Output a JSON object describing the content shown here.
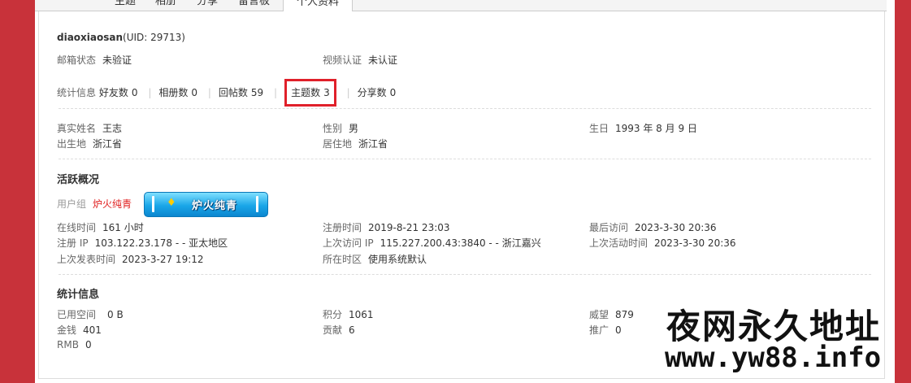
{
  "tabs": [
    "主题",
    "相册",
    "分享",
    "留言板",
    "个人资料"
  ],
  "profile": {
    "username": "diaoxiaosan",
    "uid": "(UID: 29713)",
    "email_label": "邮箱状态",
    "email_value": "未验证",
    "video_label": "视频认证",
    "video_value": "未认证"
  },
  "stats_bar": {
    "label": "统计信息",
    "items": [
      {
        "label": "好友数",
        "count": "0"
      },
      {
        "label": "相册数",
        "count": "0"
      },
      {
        "label": "回帖数",
        "count": "59"
      },
      {
        "label": "主题数",
        "count": "3"
      },
      {
        "label": "分享数",
        "count": "0"
      }
    ]
  },
  "personal": {
    "realname_label": "真实姓名",
    "realname": "王志",
    "gender_label": "性别",
    "gender": "男",
    "birthday_label": "生日",
    "birthday": "1993 年 8 月 9 日",
    "birthplace_label": "出生地",
    "birthplace": "浙江省",
    "residence_label": "居住地",
    "residence": "浙江省"
  },
  "activity": {
    "title": "活跃概况",
    "group_label": "用户组",
    "group_name": "炉火纯青",
    "badge_text": "炉火纯青",
    "online_label": "在线时间",
    "online": "161 小时",
    "reg_time_label": "注册时间",
    "reg_time": "2019-8-21 23:03",
    "last_visit_label": "最后访问",
    "last_visit": "2023-3-30 20:36",
    "reg_ip_label": "注册 IP",
    "reg_ip": "103.122.23.178 - - 亚太地区",
    "last_ip_label": "上次访问 IP",
    "last_ip": "115.227.200.43:3840 - - 浙江嘉兴",
    "last_active_label": "上次活动时间",
    "last_active": "2023-3-30 20:36",
    "last_post_label": "上次发表时间",
    "last_post": "2023-3-27 19:12",
    "timezone_label": "所在时区",
    "timezone": "使用系统默认"
  },
  "statistics": {
    "title": "统计信息",
    "space_label": "已用空间",
    "space": "0 B",
    "points_label": "积分",
    "points": "1061",
    "prestige_label": "威望",
    "prestige": "879",
    "money_label": "金钱",
    "money": "401",
    "contrib_label": "贡献",
    "contrib": "6",
    "promo_label": "推广",
    "promo": "0",
    "rmb_label": "RMB",
    "rmb": "0"
  },
  "watermark": {
    "line1": "夜网永久地址",
    "line2": "www.yw88.info"
  },
  "colors": {
    "page_bg": "#c8323a",
    "highlight_border": "#e0202a",
    "group_color": "#e02020"
  }
}
